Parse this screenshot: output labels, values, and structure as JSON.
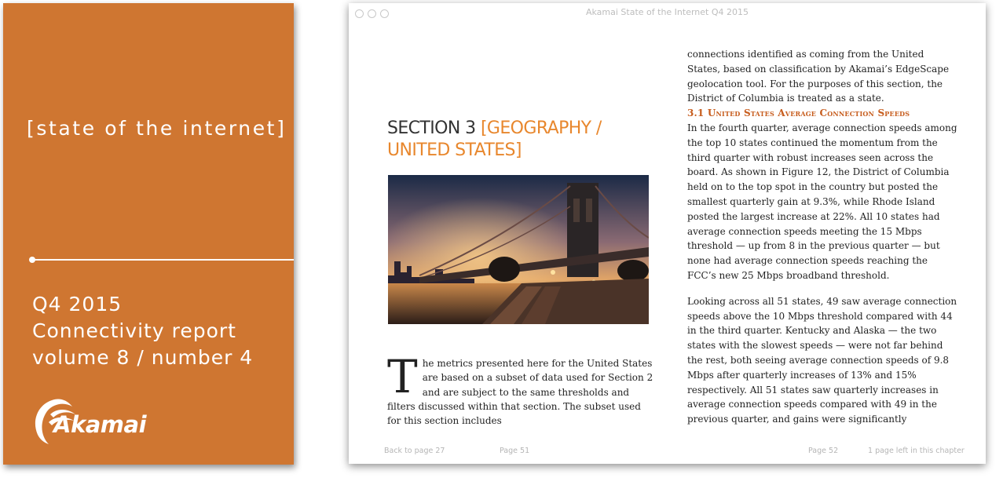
{
  "cover": {
    "title": "[state of the internet]",
    "info_lines": [
      "Q4 2015",
      "Connectivity report",
      "volume 8 / number 4"
    ],
    "logo_text": "Akamai",
    "background_color": "#cf7631"
  },
  "window": {
    "title": "Akamai State of the Internet Q4 2015"
  },
  "left_page": {
    "section_prefix": "SECTION 3",
    "section_title_line1": "[GEOGRAPHY /",
    "section_title_line2": "UNITED STATES]",
    "drop_cap": "T",
    "intro": "he metrics presented here for the United States are based on a subset of data used for Section 2 and are subject to the same thresholds and filters discussed within that section. The subset used for this section includes"
  },
  "right_page": {
    "para1": "connections identified as coming from the United States, based on classification by Akamai’s EdgeScape geolocation tool. For the purposes of this section, the District of Columbia is treated as a state.",
    "subhead": "3.1 United States Average Connection Speeds",
    "para2": "In the fourth quarter, average connection speeds among the top 10 states continued the momentum from the third quarter with robust increases seen across the board. As shown in Figure 12, the District of Columbia held on to the top spot in the country but posted the smallest quarterly gain at 9.3%, while Rhode Island posted the largest increase at 22%. All 10 states had average connection speeds meeting the 15 Mbps threshold — up from 8 in the previous quarter — but none had average connection speeds reaching the FCC’s new 25 Mbps broadband threshold.",
    "para3": "Looking across all 51 states, 49 saw average connection speeds above the 10 Mbps threshold compared with 44 in the third quarter. Kentucky and Alaska — the two states with the slowest speeds — were not far behind the rest, both seeing average connection speeds of 9.8 Mbps after quarterly increases of 13% and 15% respectively. All 51 states saw quarterly increases in average connection speeds compared with 49 in the previous quarter, and gains were significantly"
  },
  "footer": {
    "back_link": "Back to page 27",
    "page_left": "Page 51",
    "page_right": "Page 52",
    "remaining": "1 page left in this chapter"
  },
  "colors": {
    "accent": "#e8872d",
    "subhead": "#c75d1e"
  }
}
